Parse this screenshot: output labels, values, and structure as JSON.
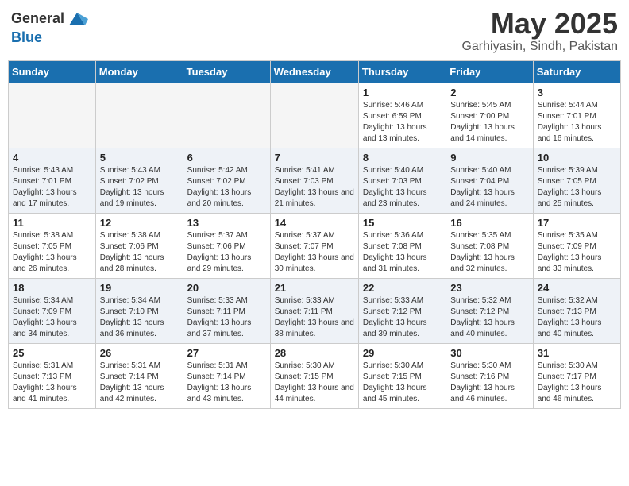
{
  "header": {
    "logo_line1": "General",
    "logo_line2": "Blue",
    "month": "May 2025",
    "location": "Garhiyasin, Sindh, Pakistan"
  },
  "days_of_week": [
    "Sunday",
    "Monday",
    "Tuesday",
    "Wednesday",
    "Thursday",
    "Friday",
    "Saturday"
  ],
  "weeks": [
    {
      "cells": [
        {
          "day": "",
          "info": ""
        },
        {
          "day": "",
          "info": ""
        },
        {
          "day": "",
          "info": ""
        },
        {
          "day": "",
          "info": ""
        },
        {
          "day": "1",
          "info": "Sunrise: 5:46 AM\nSunset: 6:59 PM\nDaylight: 13 hours and 13 minutes."
        },
        {
          "day": "2",
          "info": "Sunrise: 5:45 AM\nSunset: 7:00 PM\nDaylight: 13 hours and 14 minutes."
        },
        {
          "day": "3",
          "info": "Sunrise: 5:44 AM\nSunset: 7:01 PM\nDaylight: 13 hours and 16 minutes."
        }
      ]
    },
    {
      "cells": [
        {
          "day": "4",
          "info": "Sunrise: 5:43 AM\nSunset: 7:01 PM\nDaylight: 13 hours and 17 minutes."
        },
        {
          "day": "5",
          "info": "Sunrise: 5:43 AM\nSunset: 7:02 PM\nDaylight: 13 hours and 19 minutes."
        },
        {
          "day": "6",
          "info": "Sunrise: 5:42 AM\nSunset: 7:02 PM\nDaylight: 13 hours and 20 minutes."
        },
        {
          "day": "7",
          "info": "Sunrise: 5:41 AM\nSunset: 7:03 PM\nDaylight: 13 hours and 21 minutes."
        },
        {
          "day": "8",
          "info": "Sunrise: 5:40 AM\nSunset: 7:03 PM\nDaylight: 13 hours and 23 minutes."
        },
        {
          "day": "9",
          "info": "Sunrise: 5:40 AM\nSunset: 7:04 PM\nDaylight: 13 hours and 24 minutes."
        },
        {
          "day": "10",
          "info": "Sunrise: 5:39 AM\nSunset: 7:05 PM\nDaylight: 13 hours and 25 minutes."
        }
      ]
    },
    {
      "cells": [
        {
          "day": "11",
          "info": "Sunrise: 5:38 AM\nSunset: 7:05 PM\nDaylight: 13 hours and 26 minutes."
        },
        {
          "day": "12",
          "info": "Sunrise: 5:38 AM\nSunset: 7:06 PM\nDaylight: 13 hours and 28 minutes."
        },
        {
          "day": "13",
          "info": "Sunrise: 5:37 AM\nSunset: 7:06 PM\nDaylight: 13 hours and 29 minutes."
        },
        {
          "day": "14",
          "info": "Sunrise: 5:37 AM\nSunset: 7:07 PM\nDaylight: 13 hours and 30 minutes."
        },
        {
          "day": "15",
          "info": "Sunrise: 5:36 AM\nSunset: 7:08 PM\nDaylight: 13 hours and 31 minutes."
        },
        {
          "day": "16",
          "info": "Sunrise: 5:35 AM\nSunset: 7:08 PM\nDaylight: 13 hours and 32 minutes."
        },
        {
          "day": "17",
          "info": "Sunrise: 5:35 AM\nSunset: 7:09 PM\nDaylight: 13 hours and 33 minutes."
        }
      ]
    },
    {
      "cells": [
        {
          "day": "18",
          "info": "Sunrise: 5:34 AM\nSunset: 7:09 PM\nDaylight: 13 hours and 34 minutes."
        },
        {
          "day": "19",
          "info": "Sunrise: 5:34 AM\nSunset: 7:10 PM\nDaylight: 13 hours and 36 minutes."
        },
        {
          "day": "20",
          "info": "Sunrise: 5:33 AM\nSunset: 7:11 PM\nDaylight: 13 hours and 37 minutes."
        },
        {
          "day": "21",
          "info": "Sunrise: 5:33 AM\nSunset: 7:11 PM\nDaylight: 13 hours and 38 minutes."
        },
        {
          "day": "22",
          "info": "Sunrise: 5:33 AM\nSunset: 7:12 PM\nDaylight: 13 hours and 39 minutes."
        },
        {
          "day": "23",
          "info": "Sunrise: 5:32 AM\nSunset: 7:12 PM\nDaylight: 13 hours and 40 minutes."
        },
        {
          "day": "24",
          "info": "Sunrise: 5:32 AM\nSunset: 7:13 PM\nDaylight: 13 hours and 40 minutes."
        }
      ]
    },
    {
      "cells": [
        {
          "day": "25",
          "info": "Sunrise: 5:31 AM\nSunset: 7:13 PM\nDaylight: 13 hours and 41 minutes."
        },
        {
          "day": "26",
          "info": "Sunrise: 5:31 AM\nSunset: 7:14 PM\nDaylight: 13 hours and 42 minutes."
        },
        {
          "day": "27",
          "info": "Sunrise: 5:31 AM\nSunset: 7:14 PM\nDaylight: 13 hours and 43 minutes."
        },
        {
          "day": "28",
          "info": "Sunrise: 5:30 AM\nSunset: 7:15 PM\nDaylight: 13 hours and 44 minutes."
        },
        {
          "day": "29",
          "info": "Sunrise: 5:30 AM\nSunset: 7:15 PM\nDaylight: 13 hours and 45 minutes."
        },
        {
          "day": "30",
          "info": "Sunrise: 5:30 AM\nSunset: 7:16 PM\nDaylight: 13 hours and 46 minutes."
        },
        {
          "day": "31",
          "info": "Sunrise: 5:30 AM\nSunset: 7:17 PM\nDaylight: 13 hours and 46 minutes."
        }
      ]
    }
  ]
}
